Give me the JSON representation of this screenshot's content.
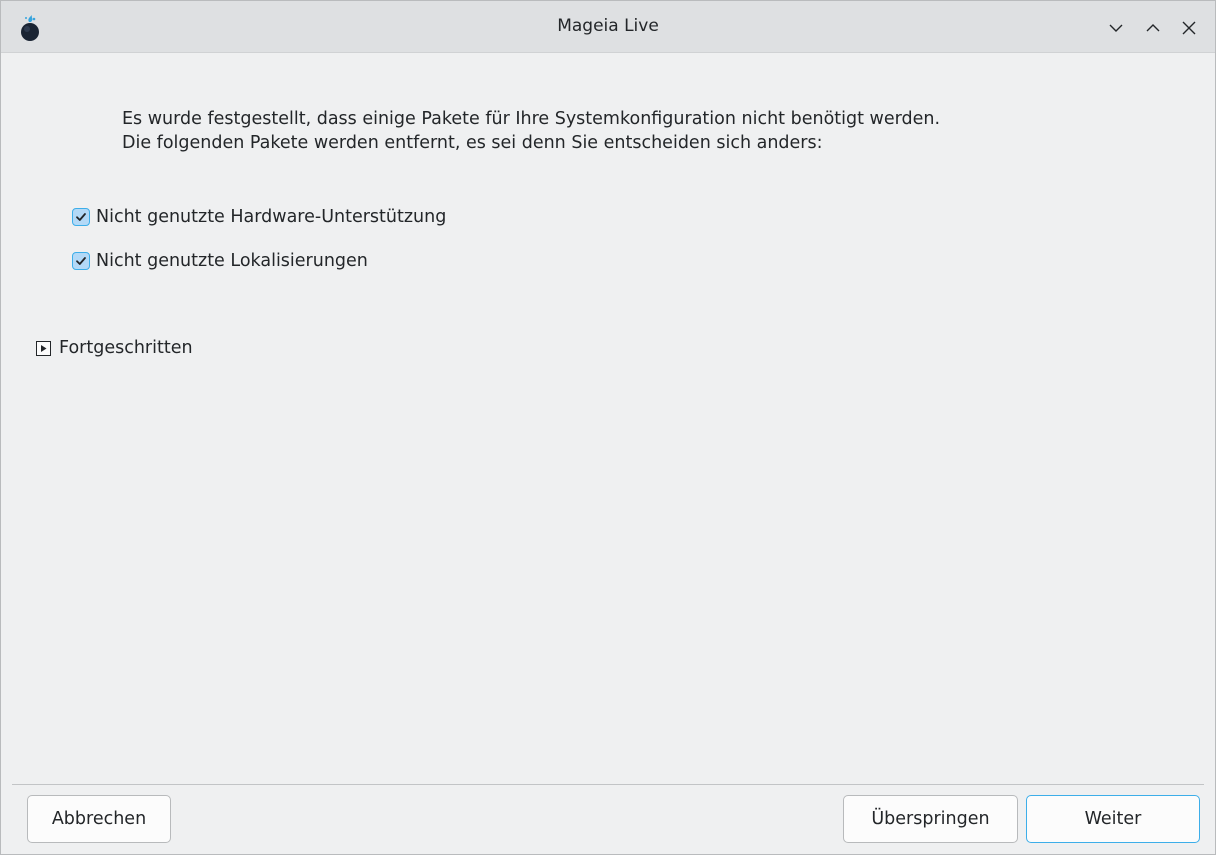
{
  "window": {
    "title": "Mageia Live",
    "controls": [
      "minimize",
      "maximize",
      "close"
    ]
  },
  "intro": {
    "line1": "Es wurde festgestellt, dass einige Pakete für Ihre Systemkonfiguration nicht benötigt werden.",
    "line2": "Die folgenden Pakete werden entfernt, es sei denn Sie entscheiden sich anders:"
  },
  "options": [
    {
      "label": "Nicht genutzte Hardware-Unterstützung",
      "checked": true
    },
    {
      "label": "Nicht genutzte Lokalisierungen",
      "checked": true
    }
  ],
  "advanced": {
    "label": "Fortgeschritten",
    "expanded": false
  },
  "buttons": {
    "cancel": "Abbrechen",
    "skip": "Überspringen",
    "next": "Weiter"
  },
  "colors": {
    "accent": "#3daee9",
    "checkbox_fill": "#b3d9f7",
    "window_bg": "#eff0f1",
    "titlebar_bg": "#dee0e2"
  }
}
